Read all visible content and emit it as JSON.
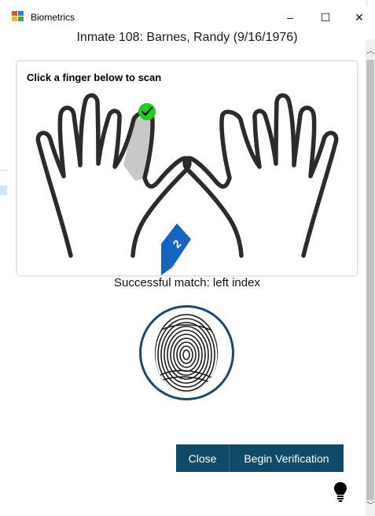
{
  "window": {
    "title": "Biometrics",
    "controls": {
      "minimize": "–",
      "maximize": "☐",
      "close": "✕"
    }
  },
  "header": {
    "inmate": "Inmate 108: Barnes, Randy (9/16/1976)"
  },
  "scanner": {
    "instruction": "Click a finger below to scan",
    "scanned_finger": "left index",
    "selected_finger_number": "2",
    "selected_finger_checked": true
  },
  "match": {
    "text": "Successful match: left index"
  },
  "buttons": {
    "close_label": "Close",
    "verify_label": "Begin Verification"
  },
  "colors": {
    "accent": "#0f4a69",
    "check": "#22cc22",
    "finger_highlight": "#c8c8c8",
    "marker": "#1565c0"
  },
  "icons": {
    "help": "lightbulb-icon",
    "app": "app-icon",
    "check": "check-icon"
  }
}
